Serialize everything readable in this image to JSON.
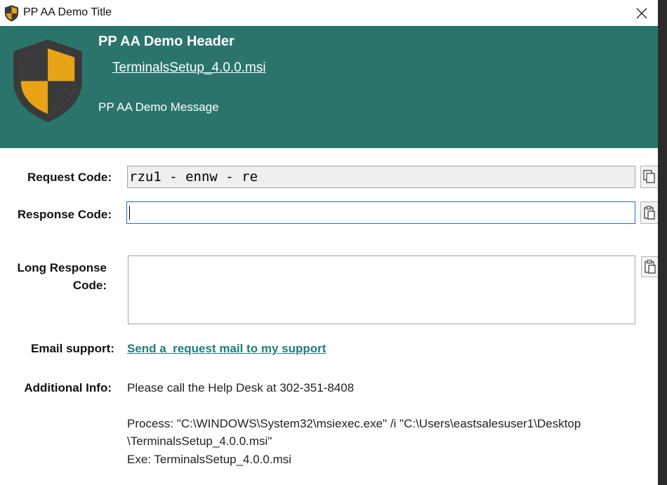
{
  "window": {
    "title": "PP AA Demo Title"
  },
  "header": {
    "title": "PP AA Demo Header",
    "file_link": "TerminalsSetup_4.0.0.msi",
    "message": "PP AA Demo Message",
    "background_color": "#2a746c"
  },
  "form": {
    "request_code": {
      "label": "Request Code:",
      "value": "rzu1 - ennw - re"
    },
    "response_code": {
      "label": "Response Code:",
      "value": ""
    },
    "long_response_code": {
      "label_line1": "Long Response",
      "label_line2": "Code:",
      "value": ""
    },
    "email_support": {
      "label": "Email support:",
      "link_text": "Send a  request mail to my support"
    },
    "additional_info": {
      "label": "Additional Info:",
      "help_desk": "Please call the Help Desk at 302-351-8408",
      "process_line1": "Process: \"C:\\WINDOWS\\System32\\msiexec.exe\" /i \"C:\\Users\\eastsalesuser1\\Desktop",
      "process_line2": "\\TerminalsSetup_4.0.0.msi\"",
      "exe_line": "Exe: TerminalsSetup_4.0.0.msi"
    }
  },
  "icons": {
    "app": "shield-icon",
    "close": "close-icon",
    "paste": "paste-icon"
  },
  "colors": {
    "accent": "#2a746c",
    "link": "#1f7f78",
    "shield_gold": "#e8a317",
    "shield_dark": "#3a3a3a"
  }
}
